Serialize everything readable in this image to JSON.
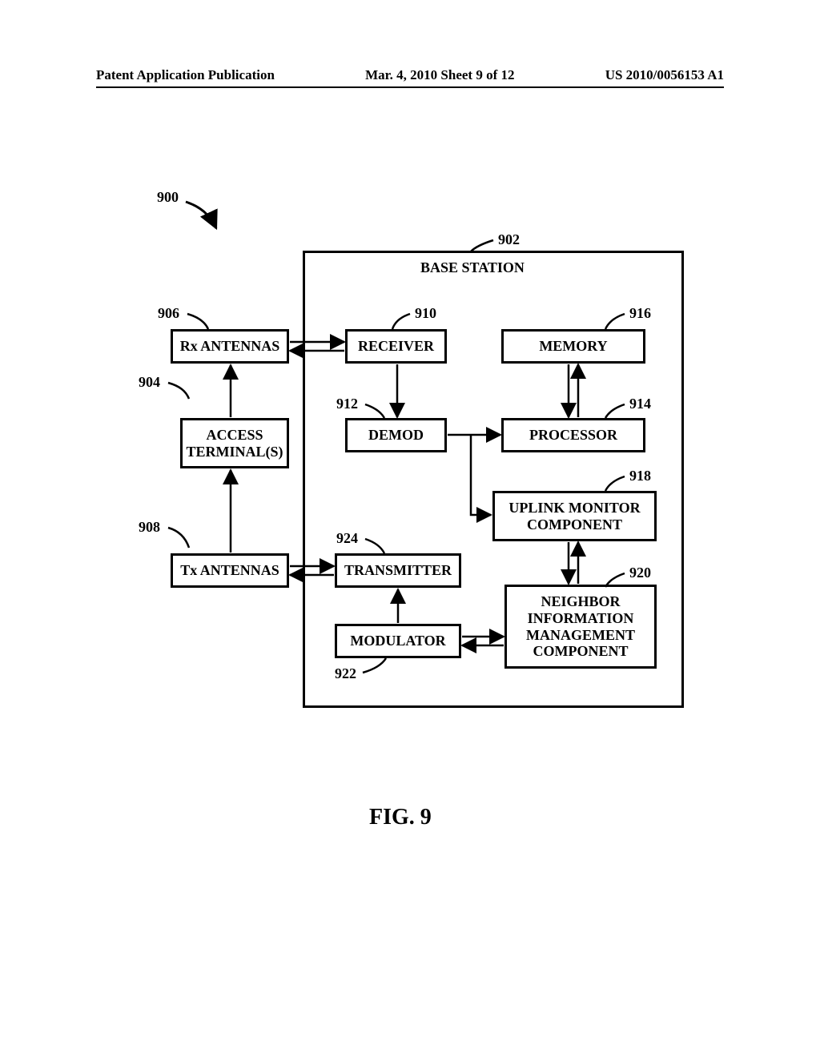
{
  "header": {
    "left": "Patent Application Publication",
    "center": "Mar. 4, 2010  Sheet 9 of 12",
    "right": "US 2010/0056153 A1"
  },
  "refs": {
    "r900": "900",
    "r902": "902",
    "r904": "904",
    "r906": "906",
    "r908": "908",
    "r910": "910",
    "r912": "912",
    "r914": "914",
    "r916": "916",
    "r918": "918",
    "r920": "920",
    "r922": "922",
    "r924": "924"
  },
  "blocks": {
    "base_station": "BASE STATION",
    "rx_antennas": "Rx ANTENNAS",
    "access_terminals_l1": "ACCESS",
    "access_terminals_l2": "TERMINAL(S)",
    "tx_antennas": "Tx ANTENNAS",
    "receiver": "RECEIVER",
    "demod": "DEMOD",
    "memory": "MEMORY",
    "processor": "PROCESSOR",
    "uplink_l1": "UPLINK MONITOR",
    "uplink_l2": "COMPONENT",
    "transmitter": "TRANSMITTER",
    "modulator": "MODULATOR",
    "neighbor_l1": "NEIGHBOR",
    "neighbor_l2": "INFORMATION",
    "neighbor_l3": "MANAGEMENT",
    "neighbor_l4": "COMPONENT"
  },
  "figure": "FIG. 9"
}
